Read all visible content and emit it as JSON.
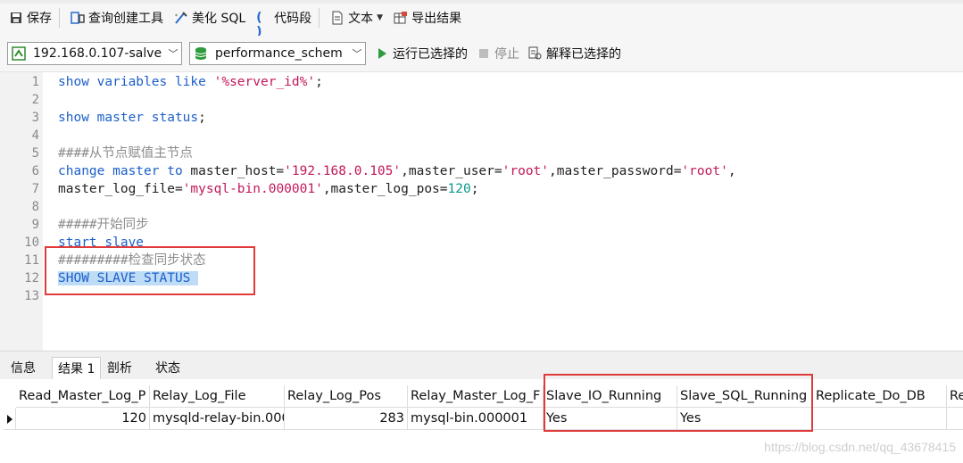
{
  "toolbar": {
    "save": "保存",
    "query_builder": "查询创建工具",
    "beautify_sql": "美化 SQL",
    "snippet": "代码段",
    "text": "文本",
    "export": "导出结果"
  },
  "connection": {
    "server": "192.168.0.107-salve",
    "database": "performance_schem",
    "run_selected": "运行已选择的",
    "stop": "停止",
    "explain_selected": "解释已选择的"
  },
  "editor": {
    "lines": [
      {
        "n": "1",
        "tokens": [
          {
            "t": "show variables like ",
            "c": "kw"
          },
          {
            "t": "'%server_id%'",
            "c": "str"
          },
          {
            "t": ";",
            "c": "plain"
          }
        ]
      },
      {
        "n": "2",
        "tokens": []
      },
      {
        "n": "3",
        "tokens": [
          {
            "t": "show master status",
            "c": "kw"
          },
          {
            "t": ";",
            "c": "plain"
          }
        ]
      },
      {
        "n": "4",
        "tokens": []
      },
      {
        "n": "5",
        "tokens": [
          {
            "t": "####从节点赋值主节点",
            "c": "cmt"
          }
        ]
      },
      {
        "n": "6",
        "tokens": [
          {
            "t": "change master to ",
            "c": "kw"
          },
          {
            "t": "master_host=",
            "c": "plain"
          },
          {
            "t": "'192.168.0.105'",
            "c": "str"
          },
          {
            "t": ",master_user=",
            "c": "plain"
          },
          {
            "t": "'root'",
            "c": "str"
          },
          {
            "t": ",master_password=",
            "c": "plain"
          },
          {
            "t": "'root'",
            "c": "str"
          },
          {
            "t": ",",
            "c": "plain"
          }
        ]
      },
      {
        "n": "7",
        "tokens": [
          {
            "t": "master_log_file=",
            "c": "plain"
          },
          {
            "t": "'mysql-bin.000001'",
            "c": "str"
          },
          {
            "t": ",master_log_pos=",
            "c": "plain"
          },
          {
            "t": "120",
            "c": "num"
          },
          {
            "t": ";",
            "c": "plain"
          }
        ]
      },
      {
        "n": "8",
        "tokens": []
      },
      {
        "n": "9",
        "tokens": [
          {
            "t": "#####开始同步",
            "c": "cmt"
          }
        ]
      },
      {
        "n": "10",
        "tokens": [
          {
            "t": "start slave",
            "c": "kw"
          }
        ]
      },
      {
        "n": "11",
        "tokens": [
          {
            "t": "#########检查同步状态",
            "c": "cmt"
          }
        ]
      },
      {
        "n": "12",
        "tokens": [
          {
            "t": "SHOW SLAVE STATUS ",
            "c": "kw sel-bg"
          }
        ]
      },
      {
        "n": "13",
        "tokens": []
      }
    ]
  },
  "result_tabs": [
    "信息",
    "结果 1",
    "剖析",
    "状态"
  ],
  "grid": {
    "columns": [
      "Read_Master_Log_P",
      "Relay_Log_File",
      "Relay_Log_Pos",
      "Relay_Master_Log_F",
      "Slave_IO_Running",
      "Slave_SQL_Running",
      "Replicate_Do_DB",
      "Re"
    ],
    "rows": [
      [
        "120",
        "mysqld-relay-bin.000",
        "283",
        "mysql-bin.000001",
        "Yes",
        "Yes",
        "",
        ""
      ]
    ]
  },
  "watermark": "https://blog.csdn.net/qq_43678415",
  "colors": {
    "highlight_box": "#e03a3a",
    "keyword": "#1c5fc9",
    "string": "#c2185b",
    "number": "#0a9a8a",
    "comment": "#8c8c8c",
    "selection": "#bfdcf7"
  }
}
